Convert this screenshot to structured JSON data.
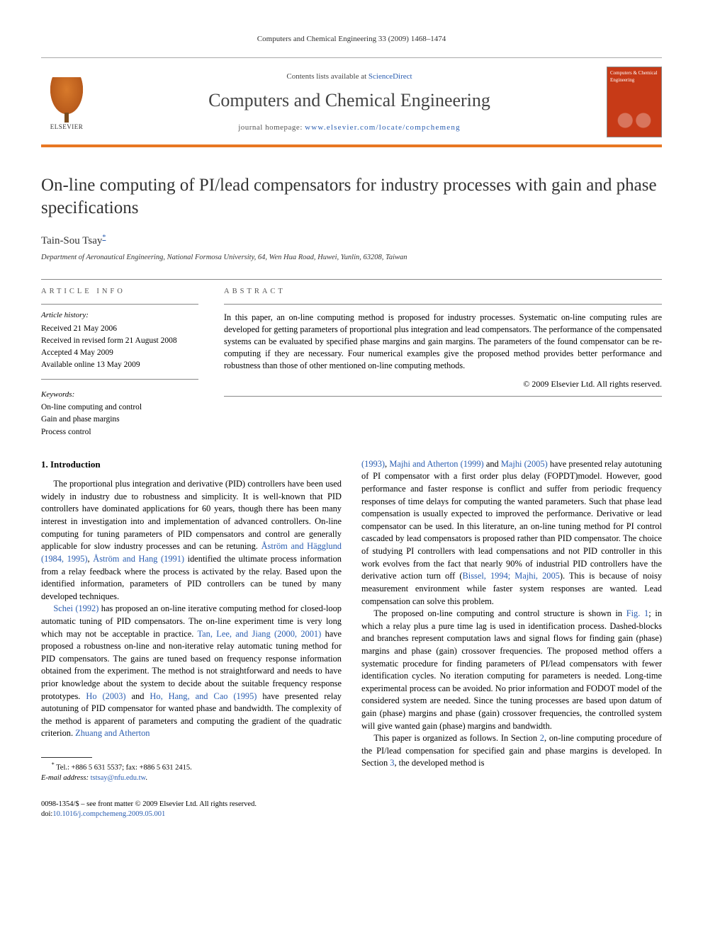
{
  "running_header": "Computers and Chemical Engineering 33 (2009) 1468–1474",
  "masthead": {
    "contents_prefix": "Contents lists available at ",
    "contents_link": "ScienceDirect",
    "journal_name": "Computers and Chemical Engineering",
    "homepage_prefix": "journal homepage: ",
    "homepage_link": "www.elsevier.com/locate/compchemeng",
    "publisher": "ELSEVIER",
    "cover_text": "Computers & Chemical Engineering"
  },
  "title": "On-line computing of PI/lead compensators for industry processes with gain and phase specifications",
  "author": "Tain-Sou Tsay",
  "author_mark": "*",
  "affiliation": "Department of Aeronautical Engineering, National Formosa University, 64, Wen Hua Road, Huwei, Yunlin, 63208, Taiwan",
  "info_heading": "article info",
  "abstract_heading": "abstract",
  "history": {
    "label": "Article history:",
    "items": [
      "Received 21 May 2006",
      "Received in revised form 21 August 2008",
      "Accepted 4 May 2009",
      "Available online 13 May 2009"
    ]
  },
  "keywords": {
    "label": "Keywords:",
    "items": [
      "On-line computing and control",
      "Gain and phase margins",
      "Process control"
    ]
  },
  "abstract": "In this paper, an on-line computing method is proposed for industry processes. Systematic on-line computing rules are developed for getting parameters of proportional plus integration and lead compensators. The performance of the compensated systems can be evaluated by specified phase margins and gain margins. The parameters of the found compensator can be re-computing if they are necessary. Four numerical examples give the proposed method provides better performance and robustness than those of other mentioned on-line computing methods.",
  "copyright": "© 2009 Elsevier Ltd. All rights reserved.",
  "section1_heading": "1.  Introduction",
  "para1a": "The proportional plus integration and derivative (PID) controllers have been used widely in industry due to robustness and simplicity. It is well-known that PID controllers have dominated applications for 60 years, though there has been many interest in investigation into and implementation of advanced controllers. On-line computing for tuning parameters of PID compensators and control are generally applicable for slow industry processes and can be retuning. ",
  "link1": "Åström and Hägglund (1984, 1995)",
  "para1b": ", ",
  "link2": "Åström and Hang (1991)",
  "para1c": " identified the ultimate process information from a relay feedback where the process is activated by the relay. Based upon the identified information, parameters of PID controllers can be tuned by many developed techniques.",
  "link3": "Schei (1992)",
  "para2a": " has proposed an on-line iterative computing method for closed-loop automatic tuning of PID compensators. The on-line experiment time is very long which may not be acceptable in practice. ",
  "link4": "Tan, Lee, and Jiang (2000, 2001)",
  "para2b": " have proposed a robustness on-line and non-iterative relay automatic tuning method for PID compensators. The gains are tuned based on frequency response information obtained from the experiment. The method is not straightforward and needs to have prior knowledge about the system to decide about the suitable frequency response prototypes. ",
  "link5": "Ho (2003)",
  "para2c": " and ",
  "link6": "Ho, Hang, and Cao (1995)",
  "para2d": " have presented relay autotuning of PID compensator for wanted phase and bandwidth. The complexity of the method is apparent of parameters and computing the gradient of the quadratic criterion. ",
  "link7": "Zhuang and Atherton",
  "link7b": "(1993)",
  "para3a": ", ",
  "link8": "Majhi and Atherton (1999)",
  "para3b": " and ",
  "link9": "Majhi (2005)",
  "para3c": " have presented relay autotuning of PI compensator with a first order plus delay (FOPDT)model. However, good performance and faster response is conflict and suffer from periodic frequency responses of time delays for computing the wanted parameters. Such that phase lead compensation is usually expected to improved the performance. Derivative or lead compensator can be used. In this literature, an on-line tuning method for PI control cascaded by lead compensators is proposed rather than PID compensator. The choice of studying PI controllers with lead compensations and not PID controller in this work evolves from the fact that nearly 90% of industrial PID controllers have the derivative action turn off (",
  "link10": "Bissel, 1994; Majhi, 2005",
  "para3d": "). This is because of noisy measurement environment while faster system responses are wanted. Lead compensation can solve this problem.",
  "para4a": "The proposed on-line computing and control structure is shown in ",
  "link11": "Fig. 1",
  "para4b": "; in which a relay plus a pure time lag is used in identification process. Dashed-blocks and branches represent computation laws and signal flows for finding gain (phase) margins and phase (gain) crossover frequencies. The proposed method offers a systematic procedure for finding parameters of PI/lead compensators with fewer identification cycles. No iteration computing for parameters is needed. Long-time experimental process can be avoided. No prior information and FODOT model of the considered system are needed. Since the tuning processes are based upon datum of gain (phase) margins and phase (gain) crossover frequencies, the controlled system will give wanted gain (phase) margins and bandwidth.",
  "para5a": "This paper is organized as follows. In Section ",
  "link12": "2",
  "para5b": ", on-line computing procedure of the PI/lead compensation for specified gain and phase margins is developed. In Section ",
  "link13": "3",
  "para5c": ", the developed method is",
  "footnote": {
    "mark": "*",
    "tel": "Tel.: +886 5 631 5537; fax: +886 5 631 2415.",
    "email_label": "E-mail address:",
    "email": "tstsay@nfu.edu.tw",
    "email_suffix": "."
  },
  "footer": {
    "line1": "0098-1354/$ – see front matter © 2009 Elsevier Ltd. All rights reserved.",
    "doi_label": "doi:",
    "doi": "10.1016/j.compchemeng.2009.05.001"
  }
}
